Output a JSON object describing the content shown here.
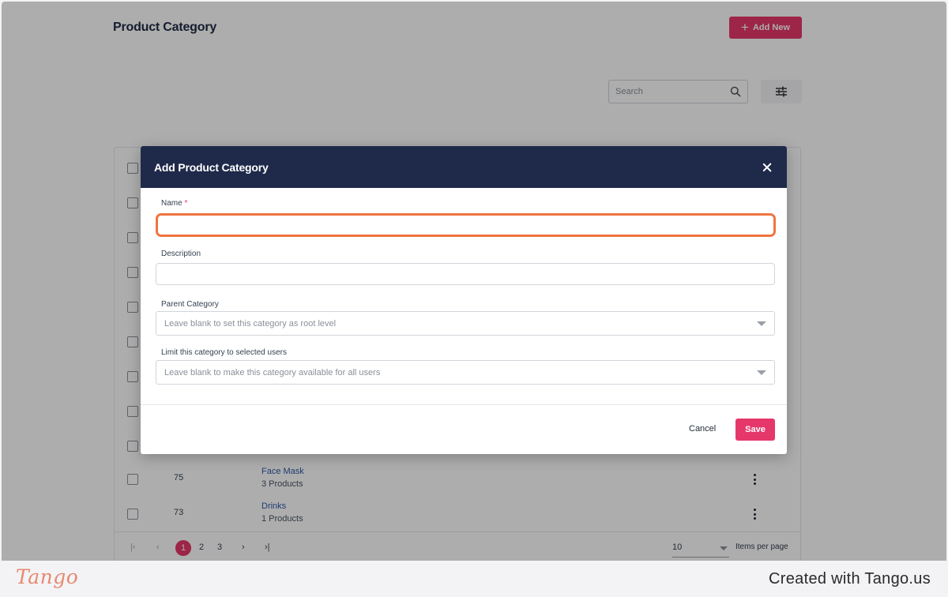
{
  "page": {
    "title": "Product Category",
    "add_new_label": "Add New",
    "search_placeholder": "Search"
  },
  "table": {
    "rows": [
      {
        "id": "75",
        "name": "Face Mask",
        "sub": "3 Products"
      },
      {
        "id": "73",
        "name": "Drinks",
        "sub": "1 Products"
      }
    ]
  },
  "pagination": {
    "pages": [
      "1",
      "2",
      "3"
    ],
    "active_page": "1",
    "per_page_value": "10",
    "per_page_label": "Items per page"
  },
  "modal": {
    "title": "Add Product Category",
    "name_label": "Name",
    "required_mark": "*",
    "name_value": "",
    "description_label": "Description",
    "description_value": "",
    "parent_label": "Parent Category",
    "parent_placeholder": "Leave blank to set this category as root level",
    "limit_label": "Limit this category to selected users",
    "limit_placeholder": "Leave blank to make this category available for all users",
    "cancel_label": "Cancel",
    "save_label": "Save"
  },
  "footer": {
    "logo_text": "Tango",
    "created_text": "Created with Tango.us"
  },
  "colors": {
    "accent": "#e6376b",
    "modal_header": "#1f2a4a",
    "focus_ring": "#f0743f"
  }
}
